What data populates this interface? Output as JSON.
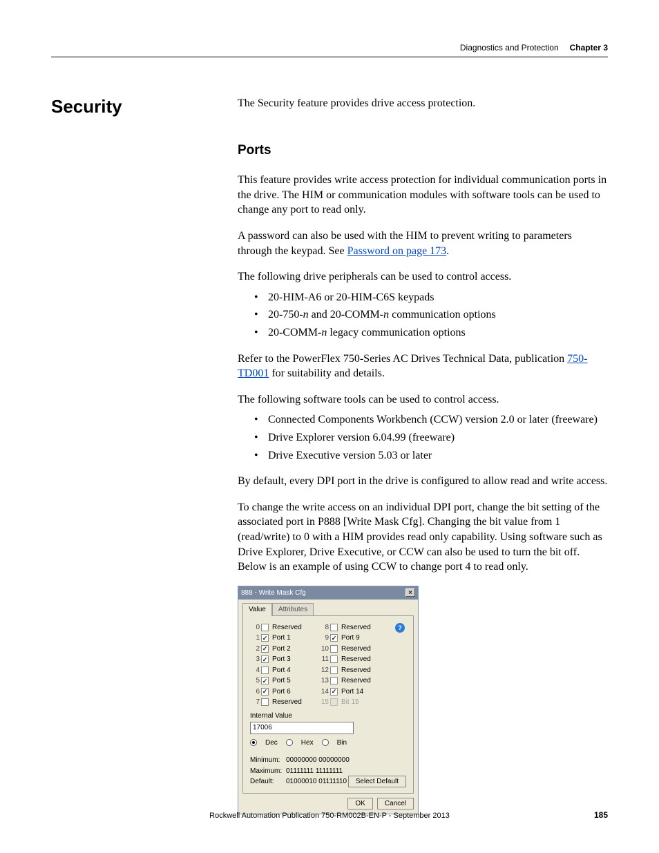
{
  "header": {
    "chapter_title": "Diagnostics and Protection",
    "chapter_label": "Chapter 3"
  },
  "section": {
    "title": "Security",
    "intro": "The Security feature provides drive access protection."
  },
  "ports": {
    "heading": "Ports",
    "p1": "This feature provides write access protection for individual communication ports in the drive. The HIM or communication modules with software tools can be used to change any port to read only.",
    "p2a": "A password can also be used with the HIM to prevent writing to parameters through the keypad. See ",
    "p2_link": "Password on page 173",
    "p2b": ".",
    "p3": "The following drive peripherals can be used to control access.",
    "periph": [
      "20-HIM-A6 or 20-HIM-C6S keypads",
      "20-750-n and 20-COMM-n communication options",
      "20-COMM-n legacy communication options"
    ],
    "p4a": "Refer to the PowerFlex 750-Series AC Drives Technical Data, publication ",
    "p4_link": "750-TD001",
    "p4b": " for suitability and details.",
    "p5": "The following software tools can be used to control access.",
    "tools": [
      "Connected Components Workbench (CCW) version 2.0 or later (freeware)",
      "Drive Explorer version 6.04.99 (freeware)",
      "Drive Executive version 5.03 or later"
    ],
    "p6": "By default, every DPI port in the drive is configured to allow read and write access.",
    "p7": "To change the write access on an individual DPI port, change the bit setting of the associated port in P888 [Write Mask Cfg]. Changing the bit value from 1 (read/write) to 0 with a HIM provides read only capability. Using software such as Drive Explorer, Drive Executive, or CCW can also be used to turn the bit off. Below is an example of using CCW to change port 4 to read only."
  },
  "dialog": {
    "title": "888 - Write Mask Cfg",
    "tabs": {
      "value": "Value",
      "attributes": "Attributes"
    },
    "bits_left": [
      {
        "n": "0",
        "label": "Reserved",
        "checked": false,
        "disabled": false
      },
      {
        "n": "1",
        "label": "Port 1",
        "checked": true,
        "disabled": false
      },
      {
        "n": "2",
        "label": "Port 2",
        "checked": true,
        "disabled": false
      },
      {
        "n": "3",
        "label": "Port 3",
        "checked": true,
        "disabled": false
      },
      {
        "n": "4",
        "label": "Port 4",
        "checked": false,
        "disabled": false
      },
      {
        "n": "5",
        "label": "Port 5",
        "checked": true,
        "disabled": false
      },
      {
        "n": "6",
        "label": "Port 6",
        "checked": true,
        "disabled": false
      },
      {
        "n": "7",
        "label": "Reserved",
        "checked": false,
        "disabled": false
      }
    ],
    "bits_right": [
      {
        "n": "8",
        "label": "Reserved",
        "checked": false,
        "disabled": false
      },
      {
        "n": "9",
        "label": "Port 9",
        "checked": true,
        "disabled": false
      },
      {
        "n": "10",
        "label": "Reserved",
        "checked": false,
        "disabled": false
      },
      {
        "n": "11",
        "label": "Reserved",
        "checked": false,
        "disabled": false
      },
      {
        "n": "12",
        "label": "Reserved",
        "checked": false,
        "disabled": false
      },
      {
        "n": "13",
        "label": "Reserved",
        "checked": false,
        "disabled": false
      },
      {
        "n": "14",
        "label": "Port 14",
        "checked": true,
        "disabled": false
      },
      {
        "n": "15",
        "label": "Bit 15",
        "checked": false,
        "disabled": true
      }
    ],
    "internal_value_label": "Internal Value",
    "internal_value": "17006",
    "radios": {
      "dec": "Dec",
      "hex": "Hex",
      "bin": "Bin",
      "selected": "dec"
    },
    "min_label": "Minimum:",
    "min_val": "00000000 00000000",
    "max_label": "Maximum:",
    "max_val": "01111111 11111111",
    "def_label": "Default:",
    "def_val": "01000010 01111110",
    "select_default": "Select Default",
    "ok": "OK",
    "cancel": "Cancel",
    "help": "?"
  },
  "footer": {
    "pub": "Rockwell Automation Publication 750-RM002B-EN-P - September 2013",
    "page": "185"
  }
}
